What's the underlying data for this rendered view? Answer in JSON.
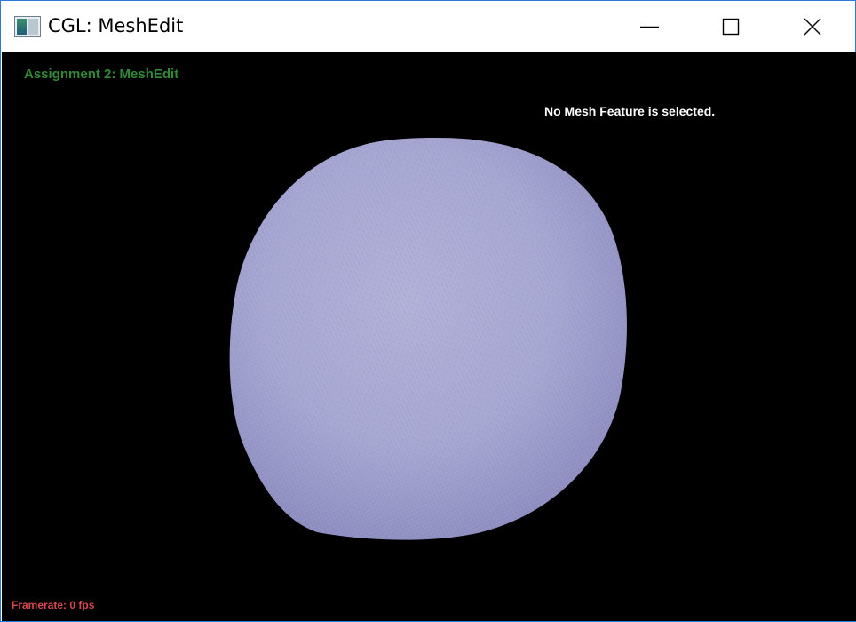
{
  "window": {
    "title": "CGL: MeshEdit",
    "icon": "app-window-icon",
    "controls": {
      "minimize_icon": "minimize-icon",
      "maximize_icon": "maximize-icon",
      "close_icon": "close-icon"
    }
  },
  "viewport": {
    "assignment_label": "Assignment 2: MeshEdit",
    "selection_status": "No Mesh Feature is selected.",
    "framerate_label": "Framerate: 0 fps",
    "colors": {
      "background": "#000000",
      "assignment_label": "#2f8a35",
      "framerate_label": "#d8484f",
      "mesh_fill": "#aaaad0",
      "mesh_wire": "#8a8ae8"
    }
  }
}
